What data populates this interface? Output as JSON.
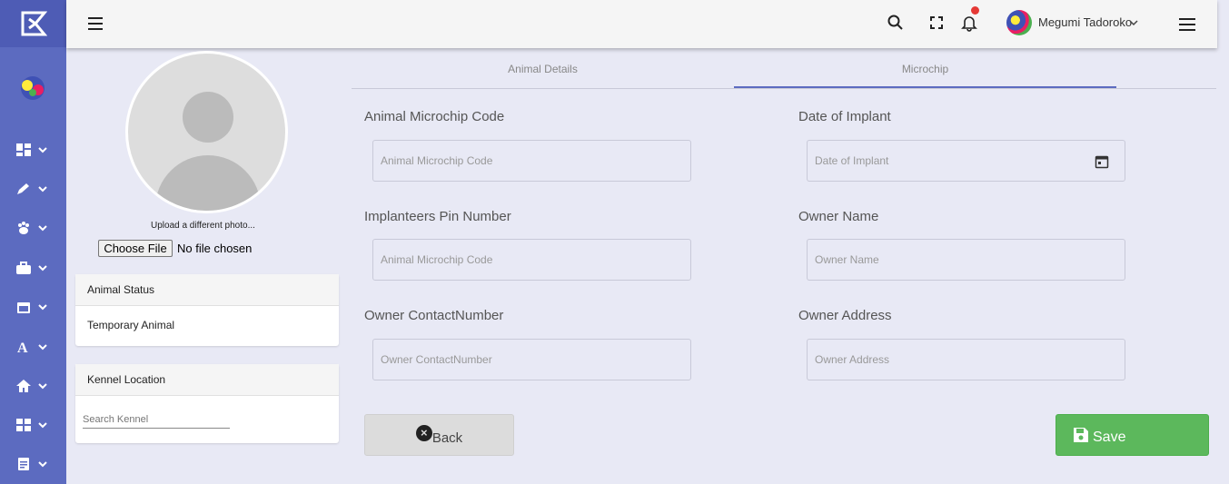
{
  "topbar": {
    "user_name": "Megumi Tadoroko"
  },
  "photo": {
    "upload_label": "Upload a different photo...",
    "file_button": "Choose File",
    "file_status": "No file chosen"
  },
  "animal_status": {
    "title": "Animal Status",
    "value": "Temporary Animal"
  },
  "kennel": {
    "title": "Kennel Location",
    "search_placeholder": "Search Kennel"
  },
  "tabs": [
    {
      "label": "Animal Details",
      "active": false
    },
    {
      "label": "Microchip",
      "active": true
    }
  ],
  "form": {
    "microchip_code": {
      "label": "Animal Microchip Code",
      "placeholder": "Animal Microchip Code"
    },
    "date_implant": {
      "label": "Date of Implant",
      "placeholder": "Date of Implant"
    },
    "pin_number": {
      "label": "Implanteers Pin Number",
      "placeholder": "Animal Microchip Code"
    },
    "owner_name": {
      "label": "Owner Name",
      "placeholder": "Owner Name"
    },
    "owner_contact": {
      "label": "Owner ContactNumber",
      "placeholder": "Owner ContactNumber"
    },
    "owner_address": {
      "label": "Owner Address",
      "placeholder": "Owner Address"
    }
  },
  "buttons": {
    "back": "Back",
    "save": "Save"
  },
  "colors": {
    "nav": "#5c6bc0",
    "accent": "#5c6bc0",
    "save": "#5cb85c",
    "notification": "#e53935"
  }
}
